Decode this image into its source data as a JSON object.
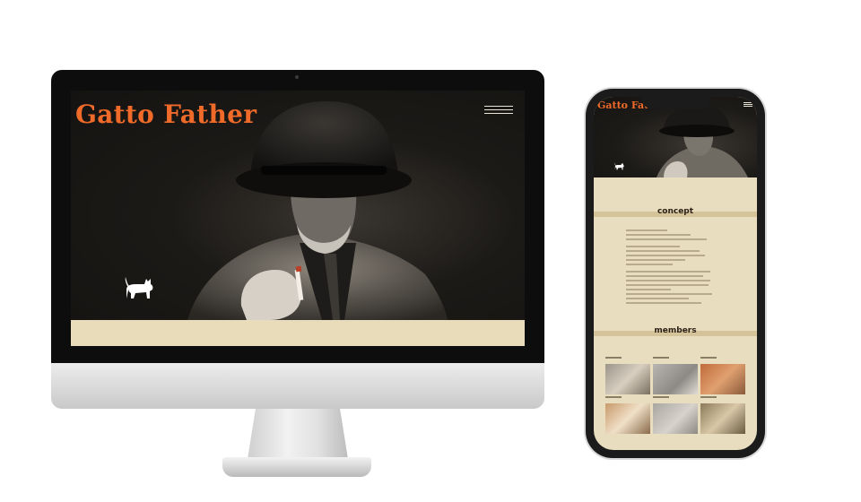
{
  "desktop": {
    "site_title": "Gatto Father"
  },
  "mobile": {
    "site_title": "Gatto Fat",
    "concept_heading": "concept",
    "members_heading": "members"
  },
  "colors": {
    "accent": "#f06a2a",
    "cream": "#e8dcbb"
  },
  "icons": [
    "menu-icon",
    "cat-icon"
  ]
}
